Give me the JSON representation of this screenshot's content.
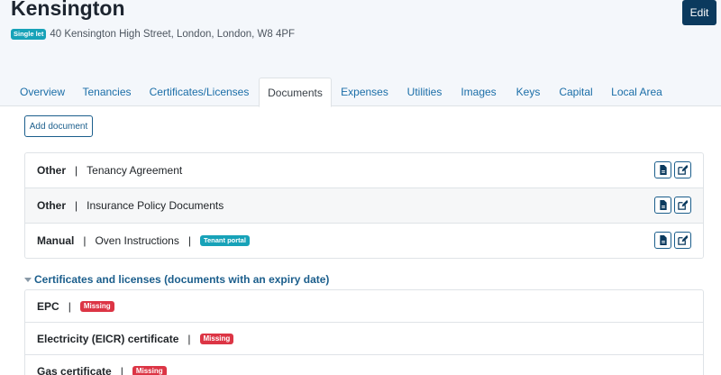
{
  "property": {
    "name": "Kensington",
    "let_type": "Single let",
    "address": "40 Kensington High Street, London, London, W8 4PF",
    "edit_label": "Edit"
  },
  "tabs": [
    {
      "label": "Overview"
    },
    {
      "label": "Tenancies"
    },
    {
      "label": "Certificates/Licenses"
    },
    {
      "label": "Documents",
      "active": true
    },
    {
      "label": "Expenses"
    },
    {
      "label": "Utilities"
    },
    {
      "label": "Images"
    },
    {
      "label": "Keys"
    },
    {
      "label": "Capital"
    },
    {
      "label": "Local Area"
    }
  ],
  "documents": {
    "add_label": "Add document",
    "separator": "|",
    "rows": [
      {
        "type": "Other",
        "name": "Tenancy Agreement"
      },
      {
        "type": "Other",
        "name": "Insurance Policy Documents"
      },
      {
        "type": "Manual",
        "name": "Oven Instructions",
        "badge": "Tenant portal"
      }
    ]
  },
  "certificates": {
    "section_label": "Certificates and licenses (documents with an expiry date)",
    "rows": [
      {
        "name": "EPC",
        "status": "Missing"
      },
      {
        "name": "Electricity (EICR) certificate",
        "status": "Missing"
      },
      {
        "name": "Gas certificate",
        "status": "Missing"
      }
    ]
  },
  "colors": {
    "primary": "#0b3a5e",
    "link": "#1b6ea8",
    "info_badge": "#17a2b8",
    "danger_badge": "#dc3545"
  }
}
